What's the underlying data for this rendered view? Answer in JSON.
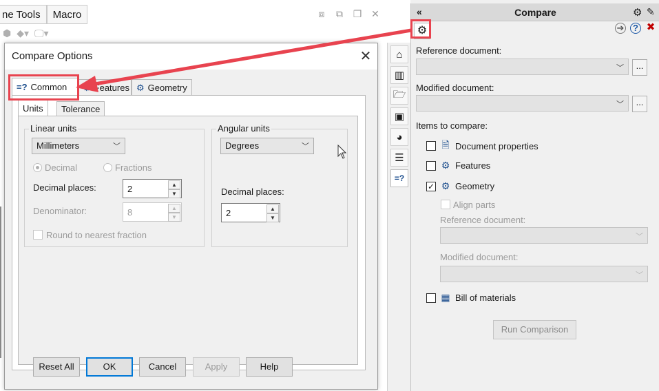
{
  "menu": {
    "tools_tab": "ne Tools",
    "macro_tab": "Macro"
  },
  "dialog": {
    "title": "Compare Options",
    "tabs": [
      {
        "label": "Common",
        "icon": "compare-equals-icon"
      },
      {
        "label": "Features",
        "icon": "features-icon"
      },
      {
        "label": "Geometry",
        "icon": "geometry-icon"
      }
    ],
    "subtabs": [
      {
        "label": "Units"
      },
      {
        "label": "Tolerance"
      }
    ],
    "linear": {
      "group_label": "Linear units",
      "units_value": "Millimeters",
      "radio_decimal": "Decimal",
      "radio_fractions": "Fractions",
      "decimal_places_label": "Decimal places:",
      "decimal_places_value": "2",
      "denominator_label": "Denominator:",
      "denominator_value": "8",
      "round_label": "Round to nearest fraction"
    },
    "angular": {
      "group_label": "Angular units",
      "units_value": "Degrees",
      "decimal_places_label": "Decimal places:",
      "decimal_places_value": "2"
    },
    "buttons": {
      "reset_all": "Reset All",
      "ok": "OK",
      "cancel": "Cancel",
      "apply": "Apply",
      "help": "Help"
    }
  },
  "side_tabs": [
    "home-icon",
    "parts-icon",
    "folder-icon",
    "view-palette-icon",
    "appearance-icon",
    "properties-icon",
    "compare-icon"
  ],
  "panel": {
    "title": "Compare",
    "reference_label": "Reference document:",
    "modified_label": "Modified document:",
    "browse_label": "...",
    "items_label": "Items to compare:",
    "items": [
      {
        "label": "Document properties",
        "checked": false
      },
      {
        "label": "Features",
        "checked": false
      },
      {
        "label": "Geometry",
        "checked": true
      },
      {
        "label": "Bill of materials",
        "checked": false
      }
    ],
    "align_parts": "Align parts",
    "sub_reference_label": "Reference document:",
    "sub_modified_label": "Modified document:",
    "run_button": "Run Comparison"
  },
  "colors": {
    "annotation": "#e8434f",
    "accent": "#0078d7"
  }
}
